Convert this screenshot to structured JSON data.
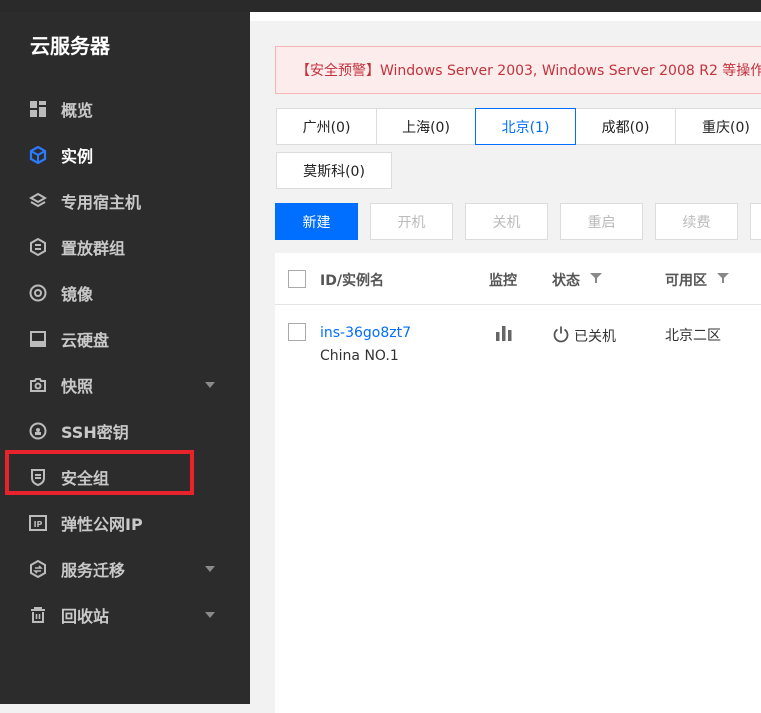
{
  "sidebar": {
    "title": "云服务器",
    "items": [
      {
        "label": "概览",
        "icon": "dashboard-icon"
      },
      {
        "label": "实例",
        "icon": "cube-icon",
        "active": true
      },
      {
        "label": "专用宿主机",
        "icon": "layers-icon"
      },
      {
        "label": "置放群组",
        "icon": "hexagon-icon"
      },
      {
        "label": "镜像",
        "icon": "disc-icon"
      },
      {
        "label": "云硬盘",
        "icon": "disk-icon"
      },
      {
        "label": "快照",
        "icon": "camera-icon",
        "expandable": true
      },
      {
        "label": "SSH密钥",
        "icon": "key-icon"
      },
      {
        "label": "安全组",
        "icon": "shield-icon"
      },
      {
        "label": "弹性公网IP",
        "icon": "ip-icon"
      },
      {
        "label": "服务迁移",
        "icon": "migrate-icon",
        "expandable": true
      },
      {
        "label": "回收站",
        "icon": "trash-icon",
        "expandable": true
      }
    ]
  },
  "alert": {
    "text": "【安全预警】Windows Server 2003, Windows Server 2008 R2 等操作"
  },
  "regions": [
    {
      "label": "广州(0)"
    },
    {
      "label": "上海(0)"
    },
    {
      "label": "北京(1)",
      "active": true
    },
    {
      "label": "成都(0)"
    },
    {
      "label": "重庆(0)"
    },
    {
      "label": "莫斯科(0)"
    }
  ],
  "toolbar": {
    "new": "新建",
    "start": "开机",
    "shutdown": "关机",
    "restart": "重启",
    "renew": "续费"
  },
  "table": {
    "columns": {
      "id": "ID/实例名",
      "monitor": "监控",
      "status": "状态",
      "zone": "可用区"
    },
    "rows": [
      {
        "id": "ins-36go8zt7",
        "name": "China NO.1",
        "status": "已关机",
        "zone": "北京二区"
      }
    ]
  },
  "colors": {
    "accent": "#006eff",
    "sidebar_bg": "#2c2c2c",
    "alert_text": "#c4323c",
    "highlight": "#e8232c"
  }
}
